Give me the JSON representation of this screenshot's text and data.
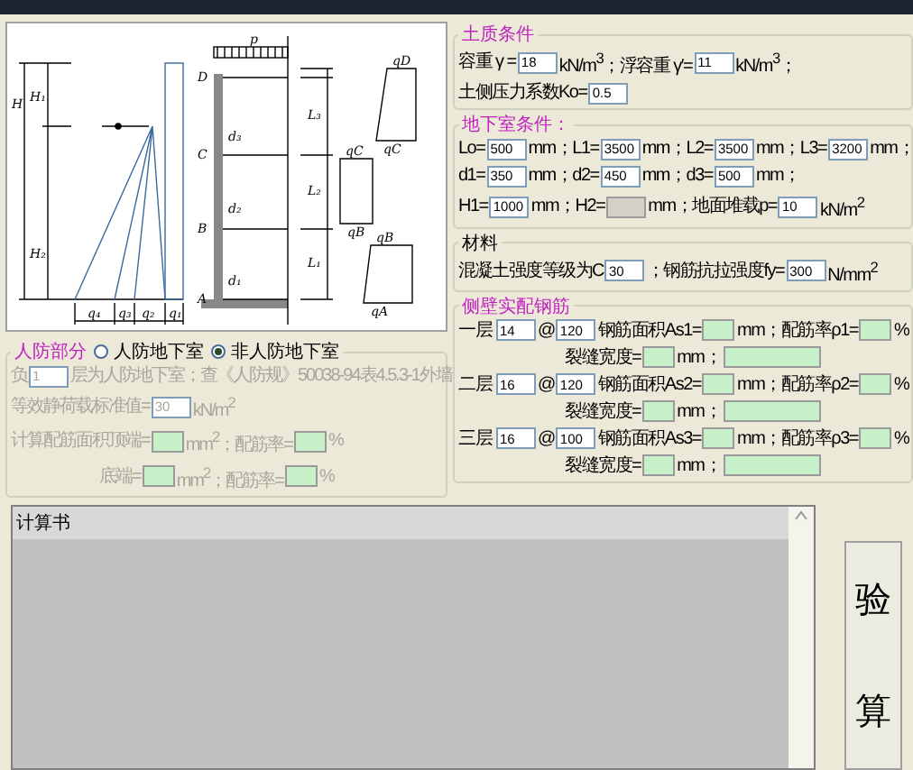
{
  "diagram": {
    "point_labels": [
      "D",
      "C",
      "B",
      "A"
    ],
    "load_label": "p",
    "height_labels": [
      "H",
      "H₁",
      "H₂"
    ],
    "pressure_labels": [
      "q₄",
      "q₃",
      "q₂",
      "q₁"
    ],
    "span_labels": [
      "L₃",
      "L₂",
      "L₁"
    ],
    "thickness_labels": [
      "d₃",
      "d₂",
      "d₁"
    ],
    "trapezoid_labels": [
      [
        "qD",
        "qC"
      ],
      [
        "qC",
        "qB"
      ],
      [
        "qB",
        "qA"
      ]
    ]
  },
  "civil_defense": {
    "legend": "人防部分",
    "accent": true,
    "disabled": true,
    "options": [
      {
        "label": "人防地下室",
        "selected": false
      },
      {
        "label": "非人防地下室",
        "selected": true
      }
    ],
    "lines": [
      {
        "items": [
          {
            "kind": "text",
            "text": "负"
          },
          {
            "kind": "input",
            "value": "1"
          },
          {
            "kind": "text",
            "text": "层为人防地下室；查《人防规》50038-94表4.5.3-1外墙"
          }
        ]
      },
      {
        "items": [
          {
            "kind": "text",
            "text": "等效静荷载标准值="
          },
          {
            "kind": "input",
            "value": "30"
          },
          {
            "kind": "text",
            "text": "kN/m$^{2}$"
          }
        ]
      },
      {
        "items": [
          {
            "kind": "text",
            "text": "计算配筋面积顶端="
          },
          {
            "kind": "result"
          },
          {
            "kind": "text",
            "text": "mm$^{2}$；配筋率="
          },
          {
            "kind": "result"
          },
          {
            "kind": "text",
            "text": "%"
          }
        ]
      },
      {
        "items": [
          {
            "kind": "gap"
          },
          {
            "kind": "text",
            "text": "底端="
          },
          {
            "kind": "result"
          },
          {
            "kind": "text",
            "text": "mm$^{2}$；配筋率="
          },
          {
            "kind": "result"
          },
          {
            "kind": "text",
            "text": "%"
          }
        ]
      }
    ]
  },
  "groups": [
    {
      "legend": "土质条件",
      "accent": true,
      "lines": [
        {
          "items": [
            {
              "kind": "text",
              "text": "容重 γ ="
            },
            {
              "kind": "input",
              "value": "18"
            },
            {
              "kind": "text",
              "text": "kN/m$^{3}$；浮容重 γ′="
            },
            {
              "kind": "input",
              "value": "11"
            },
            {
              "kind": "text",
              "text": "kN/m$^{3}$；"
            }
          ]
        },
        {
          "items": [
            {
              "kind": "text",
              "text": "土侧压力系数Ko="
            },
            {
              "kind": "input",
              "value": "0.5"
            }
          ]
        }
      ]
    },
    {
      "legend": "地下室条件：",
      "accent": true,
      "lines": [
        {
          "items": [
            {
              "kind": "text",
              "text": "Lo="
            },
            {
              "kind": "input",
              "value": "500"
            },
            {
              "kind": "text",
              "text": "mm；L1="
            },
            {
              "kind": "input",
              "value": "3500"
            },
            {
              "kind": "text",
              "text": "mm；L2="
            },
            {
              "kind": "input",
              "value": "3500"
            },
            {
              "kind": "text",
              "text": "mm；L3="
            },
            {
              "kind": "input",
              "value": "3200"
            },
            {
              "kind": "text",
              "text": "mm；"
            }
          ]
        },
        {
          "items": [
            {
              "kind": "text",
              "text": "d1="
            },
            {
              "kind": "input",
              "value": "350"
            },
            {
              "kind": "text",
              "text": "mm；d2="
            },
            {
              "kind": "input",
              "value": "450"
            },
            {
              "kind": "text",
              "text": "mm；d3="
            },
            {
              "kind": "input",
              "value": "500"
            },
            {
              "kind": "text",
              "text": "mm；"
            }
          ]
        },
        {
          "items": [
            {
              "kind": "text",
              "text": "H1="
            },
            {
              "kind": "input",
              "value": "1000"
            },
            {
              "kind": "text",
              "text": "mm；H2="
            },
            {
              "kind": "blank"
            },
            {
              "kind": "text",
              "text": "mm；地面堆载p="
            },
            {
              "kind": "input",
              "value": "10"
            },
            {
              "kind": "text",
              "text": "kN/m$^{2}$"
            }
          ]
        }
      ]
    },
    {
      "legend": "材料",
      "accent": false,
      "lines": [
        {
          "items": [
            {
              "kind": "text",
              "text": "混凝土强度等级为C"
            },
            {
              "kind": "input",
              "value": "30"
            },
            {
              "kind": "text",
              "text": "；钢筋抗拉强度fy="
            },
            {
              "kind": "input",
              "value": "300"
            },
            {
              "kind": "text",
              "text": "N/mm$^{2}$"
            }
          ]
        }
      ]
    },
    {
      "legend": "侧壁实配钢筋",
      "accent": true,
      "lines": [
        {
          "items": [
            {
              "kind": "label",
              "text": "一层"
            },
            {
              "kind": "input",
              "value": "14"
            },
            {
              "kind": "text",
              "text": "@"
            },
            {
              "kind": "input",
              "value": "120"
            },
            {
              "kind": "text",
              "text": "钢筋面积As1="
            },
            {
              "kind": "result"
            },
            {
              "kind": "text",
              "text": "mm；配筋率ρ1="
            },
            {
              "kind": "result"
            },
            {
              "kind": "text",
              "text": "%"
            }
          ]
        },
        {
          "items": [
            {
              "kind": "indent"
            },
            {
              "kind": "text",
              "text": "裂缝宽度="
            },
            {
              "kind": "result"
            },
            {
              "kind": "text",
              "text": "mm；"
            },
            {
              "kind": "result-wide"
            }
          ]
        },
        {
          "items": [
            {
              "kind": "label",
              "text": "二层"
            },
            {
              "kind": "input",
              "value": "16"
            },
            {
              "kind": "text",
              "text": "@"
            },
            {
              "kind": "input",
              "value": "120"
            },
            {
              "kind": "text",
              "text": "钢筋面积As2="
            },
            {
              "kind": "result"
            },
            {
              "kind": "text",
              "text": "mm；配筋率ρ2="
            },
            {
              "kind": "result"
            },
            {
              "kind": "text",
              "text": "%"
            }
          ]
        },
        {
          "items": [
            {
              "kind": "indent"
            },
            {
              "kind": "text",
              "text": "裂缝宽度="
            },
            {
              "kind": "result"
            },
            {
              "kind": "text",
              "text": "mm；"
            },
            {
              "kind": "result-wide"
            }
          ]
        },
        {
          "items": [
            {
              "kind": "label",
              "text": "三层"
            },
            {
              "kind": "input",
              "value": "16"
            },
            {
              "kind": "text",
              "text": "@"
            },
            {
              "kind": "input",
              "value": "100"
            },
            {
              "kind": "text",
              "text": "钢筋面积As3="
            },
            {
              "kind": "result"
            },
            {
              "kind": "text",
              "text": "mm；配筋率ρ3="
            },
            {
              "kind": "result"
            },
            {
              "kind": "text",
              "text": "%"
            }
          ]
        },
        {
          "items": [
            {
              "kind": "indent"
            },
            {
              "kind": "text",
              "text": "裂缝宽度="
            },
            {
              "kind": "result"
            },
            {
              "kind": "text",
              "text": "mm；"
            },
            {
              "kind": "result-wide"
            }
          ]
        }
      ]
    }
  ],
  "report": {
    "label": "计算书"
  },
  "calc_button": {
    "chars": [
      "验",
      "算"
    ]
  }
}
